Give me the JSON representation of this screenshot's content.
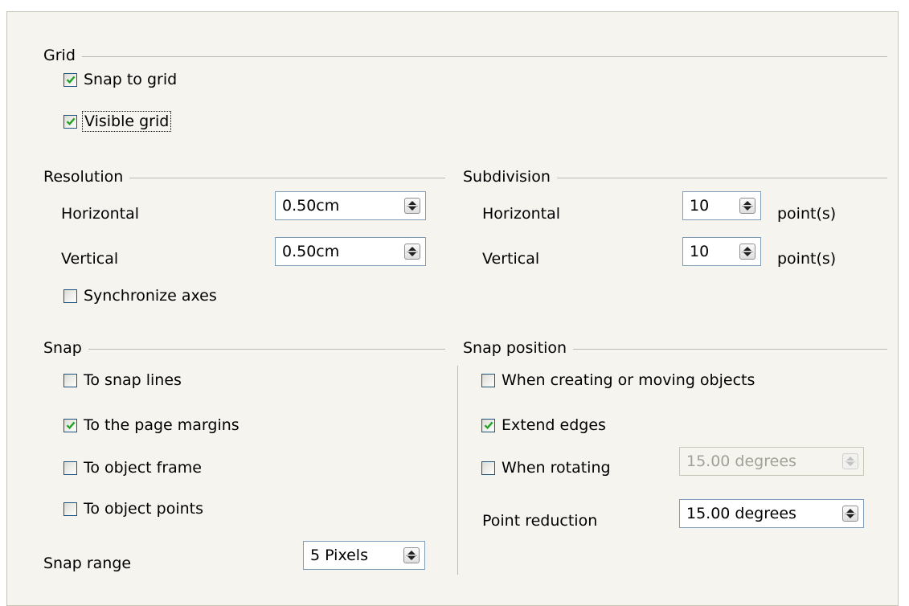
{
  "grid": {
    "title": "Grid",
    "snap_to_grid": {
      "label": "Snap to grid",
      "checked": true
    },
    "visible_grid": {
      "label": "Visible grid",
      "checked": true
    }
  },
  "resolution": {
    "title": "Resolution",
    "horizontal_label": "Horizontal",
    "horizontal_value": "0.50cm",
    "vertical_label": "Vertical",
    "vertical_value": "0.50cm",
    "synchronize": {
      "label": "Synchronize axes",
      "checked": false
    }
  },
  "subdivision": {
    "title": "Subdivision",
    "horizontal_label": "Horizontal",
    "horizontal_value": "10",
    "vertical_label": "Vertical",
    "vertical_value": "10",
    "unit": "point(s)"
  },
  "snap": {
    "title": "Snap",
    "to_snap_lines": {
      "label": "To snap lines",
      "checked": false
    },
    "to_page_margins": {
      "label": "To the page margins",
      "checked": true
    },
    "to_object_frame": {
      "label": "To object frame",
      "checked": false
    },
    "to_object_points": {
      "label": "To object points",
      "checked": false
    },
    "range_label": "Snap range",
    "range_value": "5 Pixels"
  },
  "snap_position": {
    "title": "Snap position",
    "when_creating": {
      "label": "When creating or moving objects",
      "checked": false
    },
    "extend_edges": {
      "label": "Extend edges",
      "checked": true
    },
    "when_rotating": {
      "label": "When rotating",
      "checked": false
    },
    "rotating_value": "15.00 degrees",
    "point_reduction_label": "Point reduction",
    "point_reduction_value": "15.00 degrees"
  },
  "colors": {
    "panel_bg": "#f5f4ef",
    "check": "#21a121",
    "field_border": "#7f9db9",
    "checkbox_border": "#1c5180"
  }
}
